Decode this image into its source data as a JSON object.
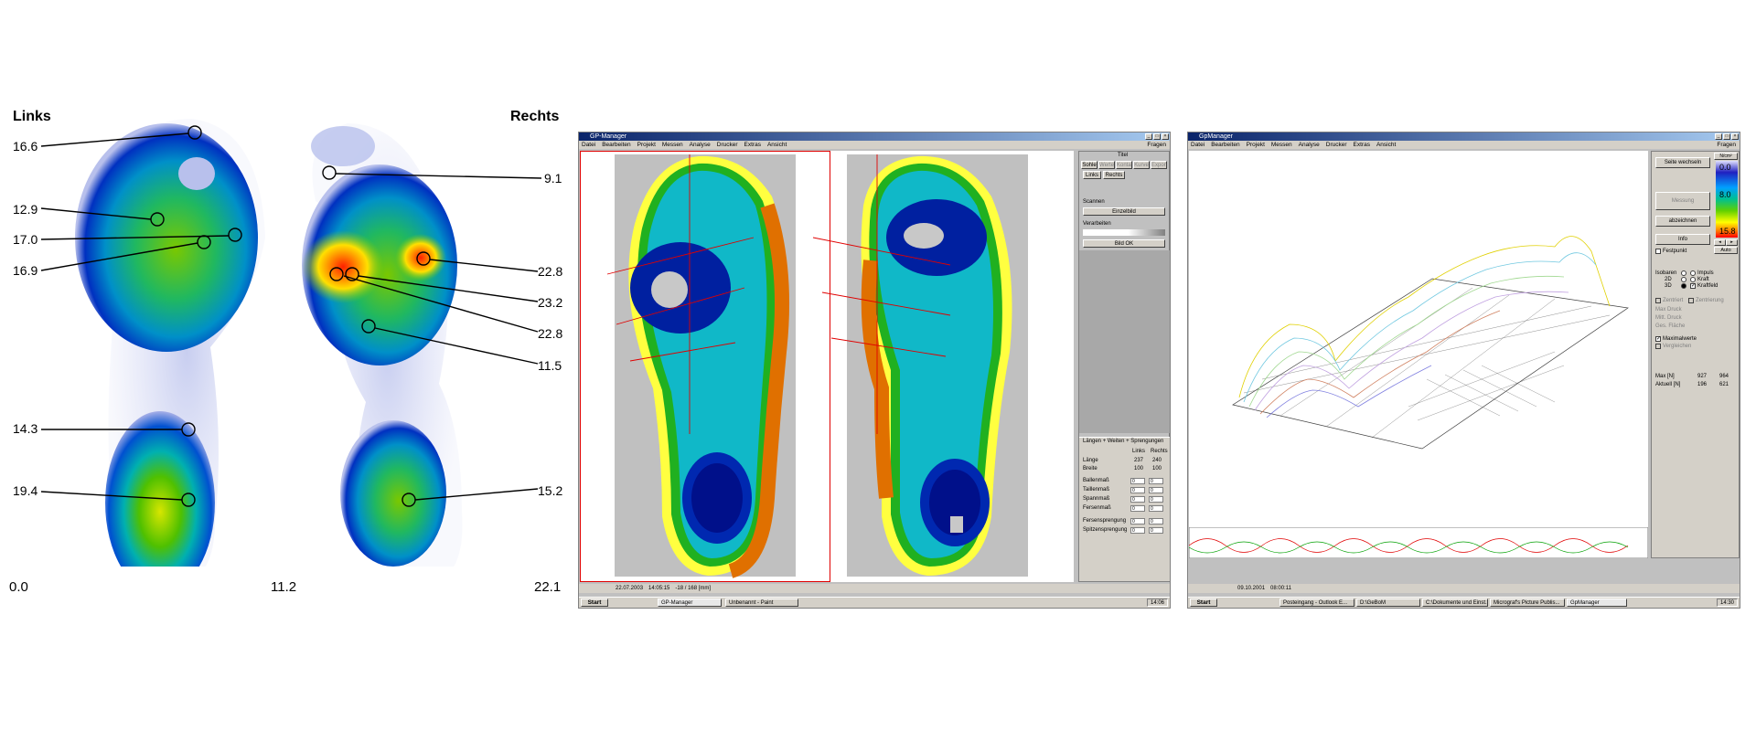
{
  "left_figure": {
    "left_label": "Links",
    "right_label": "Rechts",
    "left_values": [
      "16.6",
      "12.9",
      "17.0",
      "16.9",
      "14.3",
      "19.4"
    ],
    "right_values": [
      "9.1",
      "22.8",
      "23.2",
      "22.8",
      "11.5",
      "15.2"
    ],
    "colorbar": {
      "min": "0.0",
      "mid": "11.2",
      "max": "22.1"
    }
  },
  "window1": {
    "title": "GP-Manager",
    "menu": [
      "Datei",
      "Bearbeiten",
      "Projekt",
      "Messen",
      "Analyse",
      "Drucker",
      "Extras",
      "Ansicht"
    ],
    "help": "Fragen",
    "panel_title": "Titel",
    "tabs": [
      "Sohle",
      "Werte",
      "Kontakt",
      "Kurve",
      "Export"
    ],
    "subtabs": [
      "Links",
      "Rechts"
    ],
    "scan_label": "Scannen",
    "single_image_btn": "Einzelbild",
    "process_label": "Verarbeiten",
    "image_ok_btn": "Bild OK",
    "measures_title": "Längen + Weiten + Sprengungen",
    "col_links": "Links",
    "col_rechts": "Rechts",
    "rows": [
      {
        "label": "Länge",
        "links": "237",
        "rechts": "240"
      },
      {
        "label": "Breite",
        "links": "100",
        "rechts": "100"
      }
    ],
    "rows2": [
      {
        "label": "Ballenmaß",
        "links": "0",
        "rechts": "0"
      },
      {
        "label": "Taillenmaß",
        "links": "0",
        "rechts": "0"
      },
      {
        "label": "Spannmaß",
        "links": "0",
        "rechts": "0"
      },
      {
        "label": "Fersenmaß",
        "links": "0",
        "rechts": "0"
      },
      {
        "label": "Fersensprengung",
        "links": "0",
        "rechts": "0"
      },
      {
        "label": "Spitzensprengung",
        "links": "0",
        "rechts": "0"
      }
    ],
    "status_date": "22.07.2003",
    "status_time": "14:05:15",
    "status_info": "-18 / 168 [mm]",
    "taskbar": {
      "start": "Start",
      "tasks": [
        "GP-Manager",
        "Unbenannt - Paint"
      ],
      "clock": "14:06"
    }
  },
  "window2": {
    "title": "GpManager",
    "menu": [
      "Datei",
      "Bearbeiten",
      "Projekt",
      "Messen",
      "Analyse",
      "Drucker",
      "Extras",
      "Ansicht"
    ],
    "help": "Fragen",
    "buttons": [
      "Seite wechseln",
      "Messung",
      "abzeichnen",
      "Info"
    ],
    "fixed_label": "Festpunkt",
    "views": [
      "3D",
      "3D",
      "3D"
    ],
    "view_opts": [
      "Impuls",
      "Kraft",
      "Kraftfeld"
    ],
    "view_left": [
      "Isobaren",
      "2D",
      "3D"
    ],
    "options": [
      "Zentriert",
      "Zentrierung",
      "Max Druck",
      "Mitt. Druck",
      "Ges. Fläche"
    ],
    "max_label": "Maximalwerte",
    "comp_label": "Vergleichen",
    "stats": [
      {
        "label": "Max [N]",
        "a": "927",
        "b": "964"
      },
      {
        "label": "Aktuell [N]",
        "a": "196",
        "b": "621"
      }
    ],
    "unit": "N/cm²",
    "scale": {
      "top": "0.0",
      "mid": "8.0",
      "bottom": "15.8"
    },
    "auto": "Auto",
    "status_time": "09.10.2001",
    "status_clock": "08:00:11",
    "taskbar": {
      "start": "Start",
      "tasks": [
        "Posteingang - Outlook E...",
        "D:\\GeBoM",
        "C:\\Dokumente und Einst...",
        "Micrograf's Picture Publis...",
        "GpManager"
      ],
      "clock": "14:30"
    }
  }
}
